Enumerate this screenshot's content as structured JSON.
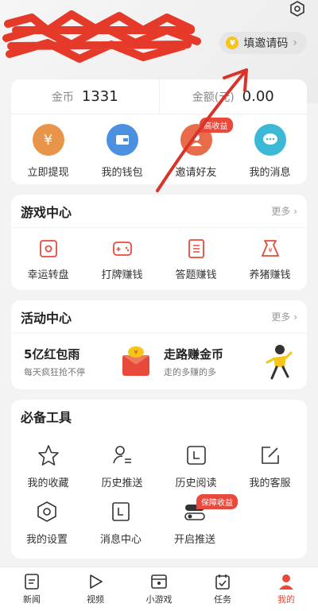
{
  "header": {
    "invite_label": "填邀请码",
    "invite_chevron": "›"
  },
  "balance": {
    "coins_label": "金币",
    "coins_value": "1331",
    "amount_label": "金额(元)",
    "amount_value": "0.00"
  },
  "quick_actions": [
    {
      "label": "立即提现",
      "icon": "yen-icon",
      "color": "#e8944a"
    },
    {
      "label": "我的钱包",
      "icon": "wallet-icon",
      "color": "#4a8fe0"
    },
    {
      "label": "邀请好友",
      "icon": "person-icon",
      "color": "#e86b4a",
      "badge": "高收益"
    },
    {
      "label": "我的消息",
      "icon": "chat-icon",
      "color": "#3bb8d6"
    }
  ],
  "games": {
    "title": "游戏中心",
    "more": "更多 ›",
    "items": [
      {
        "label": "幸运转盘",
        "icon": "wheel-icon"
      },
      {
        "label": "打牌赚钱",
        "icon": "gamepad-icon"
      },
      {
        "label": "答题赚钱",
        "icon": "quiz-icon"
      },
      {
        "label": "养猪赚钱",
        "icon": "pig-bag-icon"
      }
    ]
  },
  "activity": {
    "title": "活动中心",
    "more": "更多 ›",
    "items": [
      {
        "title": "5亿红包雨",
        "sub": "每天疯狂抢不停",
        "icon": "red-envelope-icon"
      },
      {
        "title": "走路赚金币",
        "sub": "走的多赚的多",
        "icon": "walking-person-icon"
      }
    ]
  },
  "tools": {
    "title": "必备工具",
    "row1": [
      {
        "label": "我的收藏",
        "icon": "star-icon"
      },
      {
        "label": "历史推送",
        "icon": "user-list-icon"
      },
      {
        "label": "历史阅读",
        "icon": "history-icon"
      },
      {
        "label": "我的客服",
        "icon": "edit-icon"
      }
    ],
    "row2": [
      {
        "label": "我的设置",
        "icon": "hexagon-settings-icon"
      },
      {
        "label": "消息中心",
        "icon": "message-box-icon"
      },
      {
        "label": "开启推送",
        "icon": "toggle-icon",
        "badge": "保障收益"
      }
    ]
  },
  "tabs": [
    {
      "label": "新闻",
      "icon": "news-icon"
    },
    {
      "label": "视频",
      "icon": "play-icon"
    },
    {
      "label": "小游戏",
      "icon": "mini-game-icon"
    },
    {
      "label": "任务",
      "icon": "task-icon"
    },
    {
      "label": "我的",
      "icon": "profile-icon",
      "active": true
    }
  ],
  "colors": {
    "accent": "#e8493b",
    "redact": "#e53a2a"
  }
}
